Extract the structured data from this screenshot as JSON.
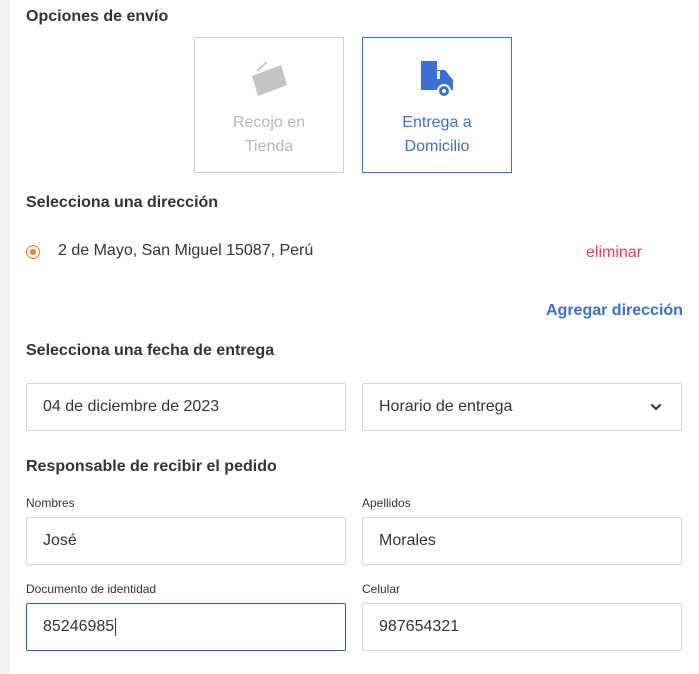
{
  "shipping": {
    "title": "Opciones de envío",
    "options": [
      {
        "line1": "Recojo en",
        "line2": "Tienda",
        "icon": "store-card-icon",
        "state": "disabled"
      },
      {
        "line1": "Entrega a",
        "line2": "Domicilio",
        "icon": "delivery-truck-icon",
        "state": "selected"
      }
    ]
  },
  "address": {
    "title": "Selecciona una dirección",
    "selected": "2 de Mayo, San Miguel 15087, Perú",
    "delete_label": "eliminar",
    "add_label": "Agregar dirección"
  },
  "delivery": {
    "title": "Selecciona una fecha de entrega",
    "date_value": "04 de diciembre de 2023",
    "schedule_value": "Horario de entrega"
  },
  "receiver": {
    "title": "Responsable de recibir el pedido",
    "first_name_label": "Nombres",
    "first_name_value": "José",
    "last_name_label": "Apellidos",
    "last_name_value": "Morales",
    "document_label": "Documento de identidad",
    "document_value": "85246985",
    "phone_label": "Celular",
    "phone_value": "987654321"
  },
  "colors": {
    "accent": "#3b6fd8",
    "radio": "#f07b1a",
    "danger": "#ee3b56"
  }
}
